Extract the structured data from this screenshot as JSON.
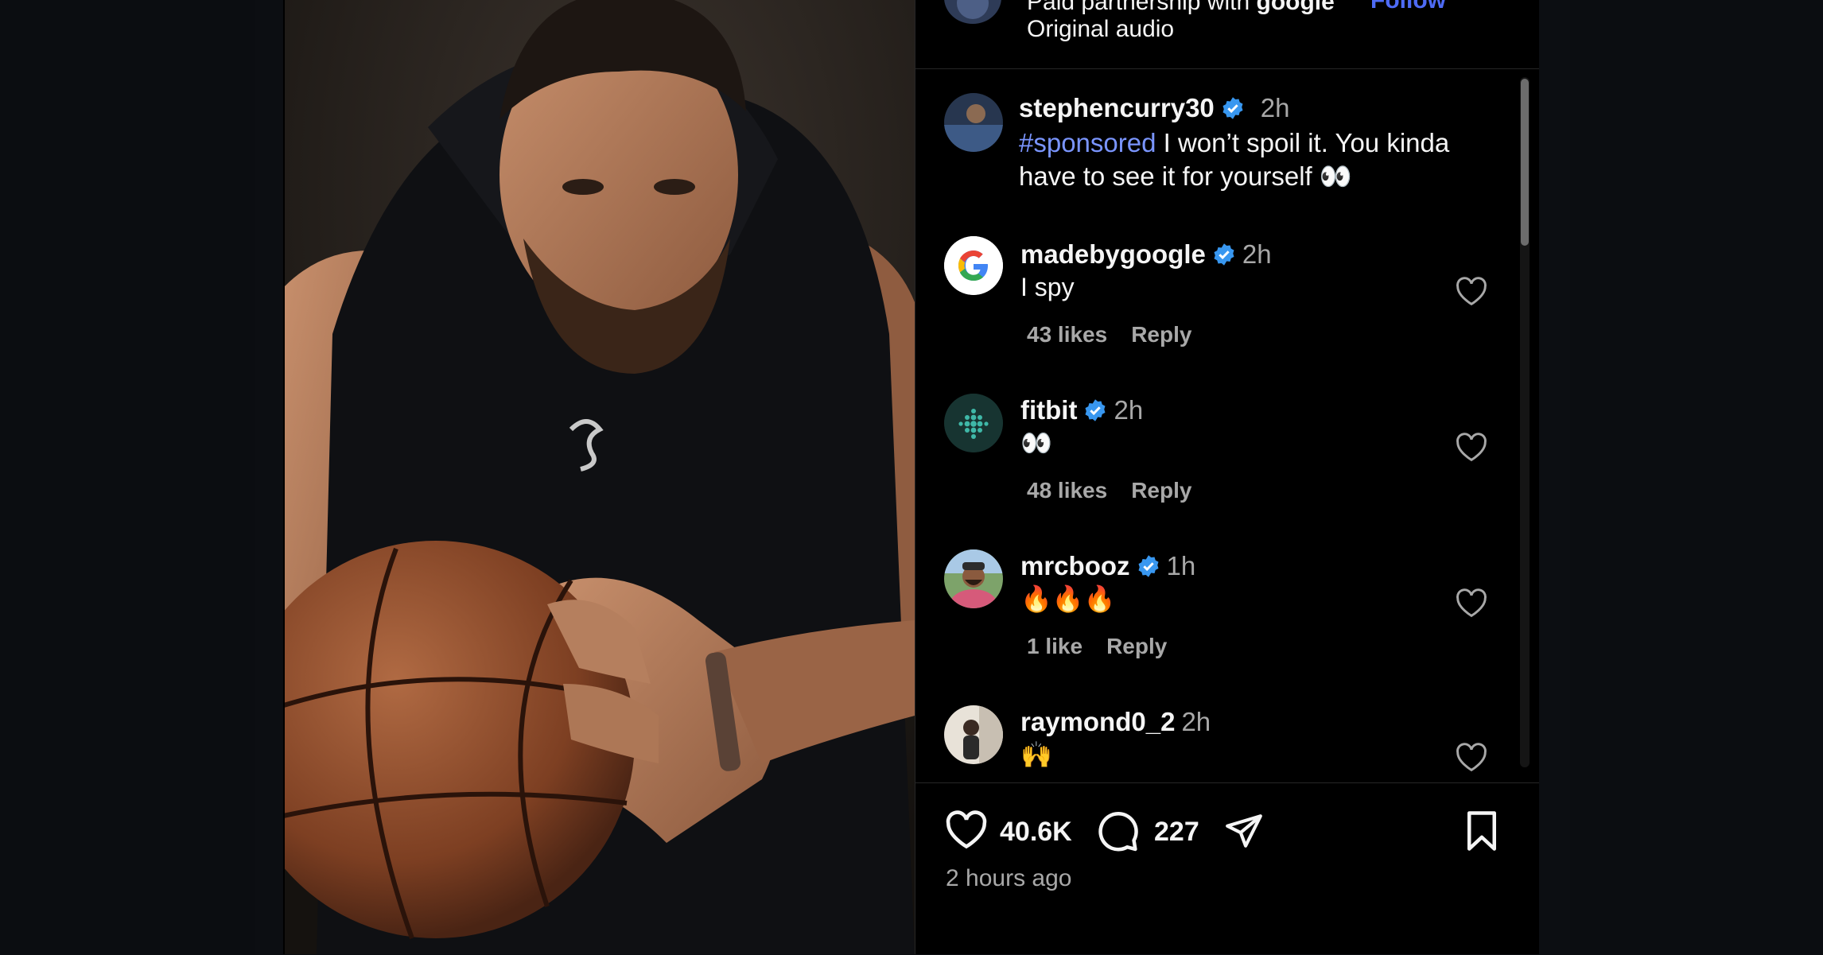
{
  "header": {
    "partner_prefix": "Paid partnership with ",
    "partner_name": "google",
    "audio": "Original audio",
    "follow": "Follow"
  },
  "caption": {
    "username": "stephencurry30",
    "time": "2h",
    "hashtag": "#sponsored",
    "text": " I won’t spoil it. You kinda have to see it for yourself 👀"
  },
  "comments": [
    {
      "username": "madebygoogle",
      "verified": true,
      "time": "2h",
      "text": "I spy",
      "likes": "43 likes",
      "reply": "Reply"
    },
    {
      "username": "fitbit",
      "verified": true,
      "time": "2h",
      "text": "👀",
      "likes": "48 likes",
      "reply": "Reply"
    },
    {
      "username": "mrcbooz",
      "verified": true,
      "time": "1h",
      "text": "🔥🔥🔥",
      "likes": "1 like",
      "reply": "Reply"
    },
    {
      "username": "raymond0_2",
      "verified": false,
      "time": "2h",
      "text": "🙌"
    }
  ],
  "actions": {
    "like_count": "40.6K",
    "comment_count": "227",
    "posted_ago": "2 hours ago"
  },
  "colors": {
    "link": "#4e6bf5",
    "hashtag": "#7a95ff",
    "verified": "#3897f0",
    "muted": "#a8a8a8"
  },
  "icons": [
    "heart-icon",
    "comment-icon",
    "share-icon",
    "bookmark-icon",
    "verified-badge-icon"
  ]
}
